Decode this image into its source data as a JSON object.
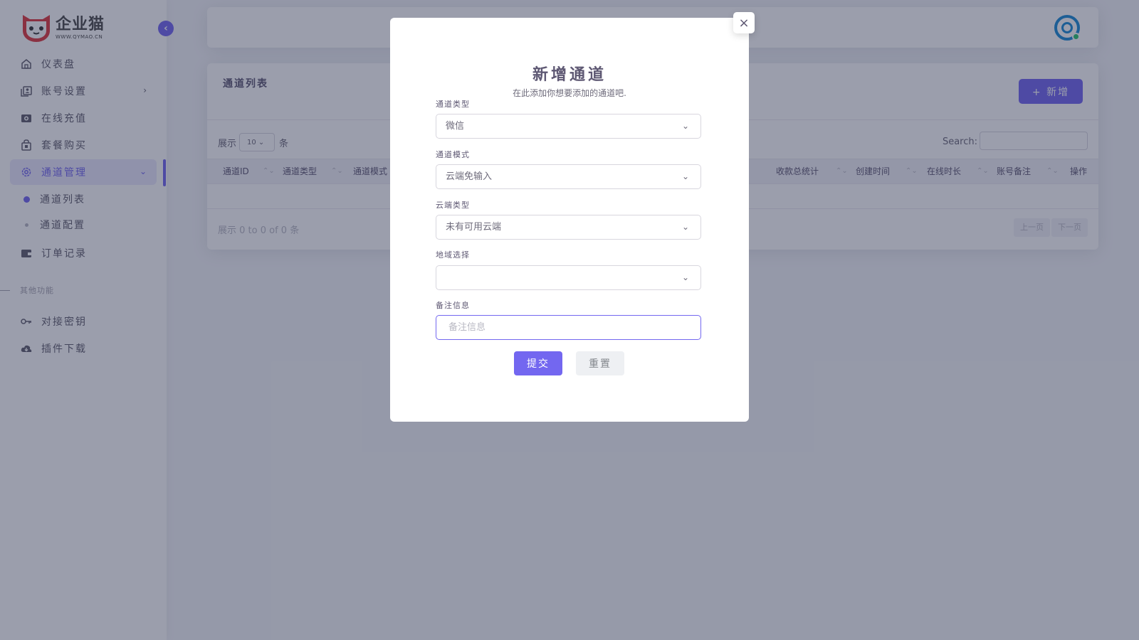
{
  "brand": {
    "name": "企业猫",
    "url_text": "WWW.QYMAO.CN"
  },
  "sidebar": {
    "collapse_icon": "‹",
    "items": [
      {
        "label": "仪表盘",
        "icon": "home-icon"
      },
      {
        "label": "账号设置",
        "icon": "user-card-icon",
        "arrow": "›"
      },
      {
        "label": "在线充值",
        "icon": "camera-icon"
      },
      {
        "label": "套餐购买",
        "icon": "bag-icon"
      },
      {
        "label": "通道管理",
        "icon": "gear-icon",
        "arrow": "⌄"
      }
    ],
    "sub_items": [
      {
        "label": "通道列表"
      },
      {
        "label": "通道配置"
      }
    ],
    "order_item": {
      "label": "订单记录",
      "icon": "wallet-icon"
    },
    "section_label": "其他功能",
    "other_items": [
      {
        "label": "对接密钥",
        "icon": "key-icon"
      },
      {
        "label": "插件下载",
        "icon": "cloud-download-icon"
      }
    ]
  },
  "card": {
    "title": "通道列表",
    "add_button": "+ 新增",
    "show_prefix": "展示",
    "page_size": "10",
    "show_suffix": "条",
    "search_label": "Search:",
    "columns": [
      "通道ID",
      "通道类型",
      "通道模式",
      "收款总统计",
      "创建时间",
      "在线时长",
      "账号备注",
      "操作"
    ],
    "info": "展示 0 to 0 of 0 条",
    "prev": "上一页",
    "next": "下一页"
  },
  "modal": {
    "close": "×",
    "title": "新增通道",
    "subtitle": "在此添加你想要添加的通道吧.",
    "fields": {
      "type_label": "通道类型",
      "type_value": "微信",
      "mode_label": "通道模式",
      "mode_value": "云端免输入",
      "cloud_label": "云端类型",
      "cloud_value": "未有可用云端",
      "region_label": "地域选择",
      "region_value": "",
      "remark_label": "备注信息",
      "remark_placeholder": "备注信息"
    },
    "submit": "提交",
    "reset": "重置"
  },
  "colors": {
    "accent": "#7367f0",
    "status": "#28c76f"
  }
}
